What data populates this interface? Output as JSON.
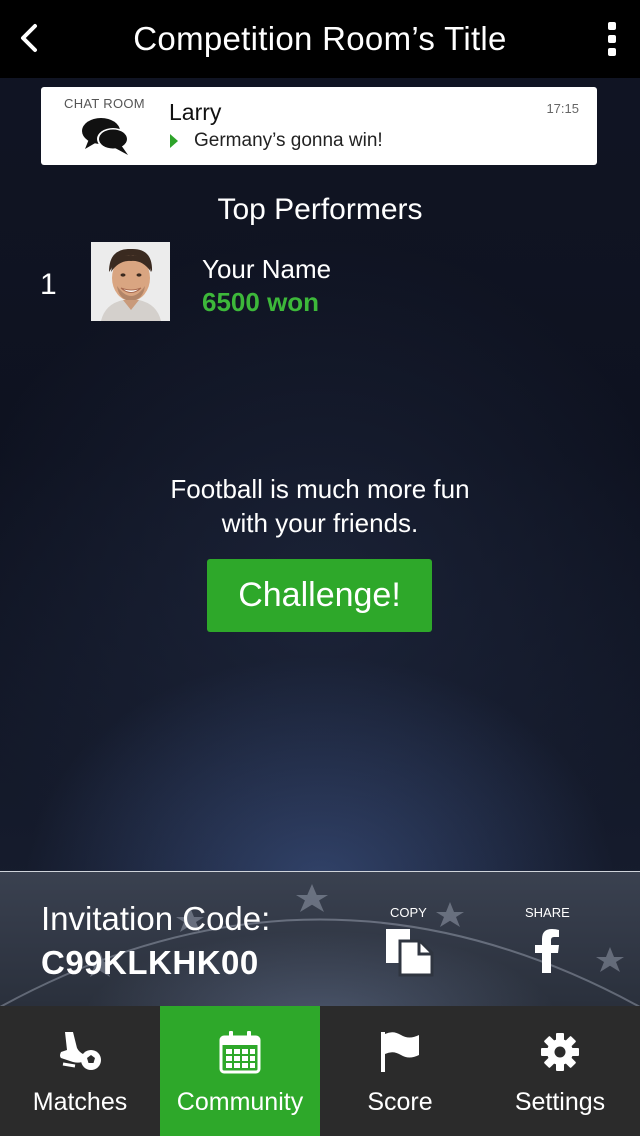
{
  "header": {
    "title": "Competition Room’s Title",
    "back_icon": "chevron-left-icon",
    "menu_icon": "more-vertical-icon"
  },
  "chat": {
    "room_label": "CHAT ROOM",
    "icon": "chat-bubbles-icon",
    "sender": "Larry",
    "time": "17:15",
    "message": "Germany’s gonna win!"
  },
  "top_performers": {
    "title": "Top Performers",
    "items": [
      {
        "rank": "1",
        "name": "Your Name",
        "score": "6500 won"
      }
    ]
  },
  "promo": {
    "line1": "Football is much more fun",
    "line2": "with your friends.",
    "button": "Challenge!"
  },
  "invitation": {
    "label": "Invitation Code:",
    "code": "C99KLKHK00",
    "copy_label": "COPY",
    "share_label": "SHARE"
  },
  "tabs": [
    {
      "label": "Matches",
      "icon": "football-boot-icon",
      "active": false
    },
    {
      "label": "Community",
      "icon": "calendar-icon",
      "active": true
    },
    {
      "label": "Score",
      "icon": "flag-icon",
      "active": false
    },
    {
      "label": "Settings",
      "icon": "gear-icon",
      "active": false
    }
  ],
  "colors": {
    "accent_green": "#2ea82a",
    "score_green": "#3db83a",
    "header_bg": "#000000",
    "tabbar_bg": "#2b2b2b"
  }
}
